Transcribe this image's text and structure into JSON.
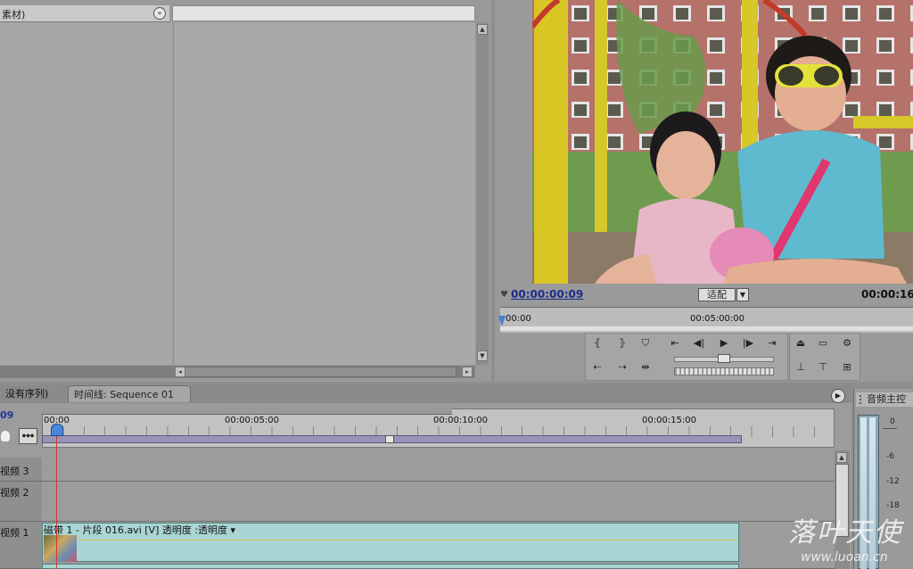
{
  "project_panel": {
    "header_label": "素材)",
    "scroll_left_label": "◂",
    "scroll_right_label": "▸"
  },
  "monitor": {
    "current_timecode": "00:00:00:09",
    "fit_label": "适配",
    "duration_timecode": "00:00:16",
    "ruler_start": "00:00",
    "ruler_mid": "00:05:00:00"
  },
  "timeline": {
    "tab_all_sequences": "没有序列)",
    "tab_sequence": "时间线: Sequence 01",
    "tab_close": "×",
    "timecode": "09",
    "ruler_labels": [
      "00:00",
      "00:00:05:00",
      "00:00:10:00",
      "00:00:15:00"
    ],
    "tracks": [
      {
        "name": "视频 3"
      },
      {
        "name": "视频 2"
      },
      {
        "name": "视频 1"
      }
    ],
    "clip_label": "磁带 1 - 片段 016.avi [V] 透明度 :透明度 ▾"
  },
  "audio_master": {
    "title": "音频主控",
    "db_labels": [
      "0",
      "-6",
      "-12",
      "-18"
    ]
  },
  "watermark": {
    "script_text": "落叶天使",
    "url": "www.luoan.cn"
  },
  "colors": {
    "clip": "#a9d6d4",
    "timecode_blue": "#1b2c8c",
    "playhead_line": "#d03a2a",
    "workarea": "#9a93b8"
  },
  "icons": {
    "project_nav": "circle-arrow-icon",
    "timeline_nav": "circle-arrow-icon",
    "set_in": "mark-in-icon",
    "set_out": "mark-out-icon",
    "marker": "marker-icon",
    "go_in": "go-to-in-icon",
    "step_back": "step-back-icon",
    "play": "play-icon",
    "step_fwd": "step-forward-icon",
    "go_out": "go-to-out-icon",
    "lift": "lift-icon",
    "extract": "extract-icon",
    "export": "export-frame-icon"
  }
}
